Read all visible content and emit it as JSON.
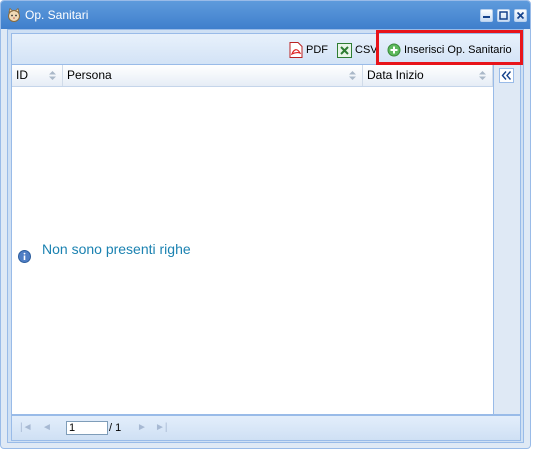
{
  "window": {
    "title": "Op. Sanitari",
    "app_icon": "cat-face-icon",
    "controls": [
      "minimize-icon",
      "maximize-icon",
      "close-icon"
    ]
  },
  "toolbar": {
    "pdf_label": "PDF",
    "csv_label": "CSV",
    "add_label": "Inserisci Op. Sanitario"
  },
  "grid": {
    "columns": [
      "ID",
      "Persona",
      "Data Inizio"
    ],
    "empty_message": "Non sono presenti righe",
    "rows": []
  },
  "pager": {
    "current_page": "1",
    "total_pages": "/ 1"
  },
  "colors": {
    "titlebar": "#4a8bd6",
    "highlight": "#e8141a",
    "empty_text": "#1b82b1"
  }
}
